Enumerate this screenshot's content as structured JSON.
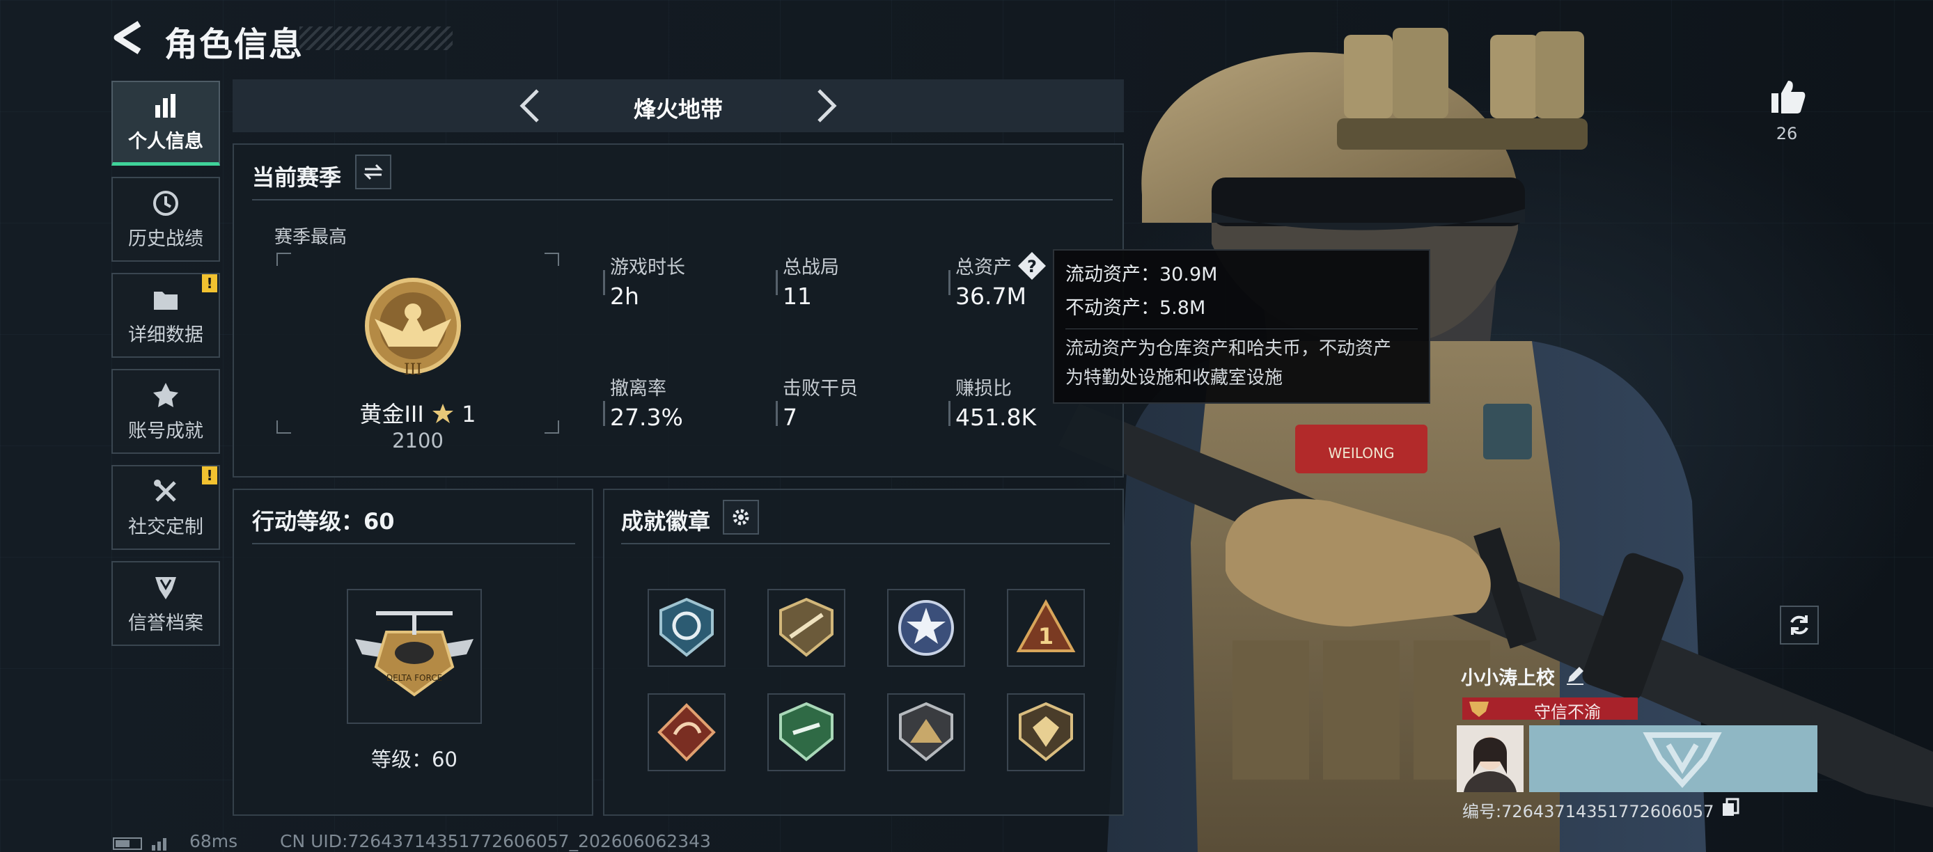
{
  "header": {
    "title": "角色信息"
  },
  "sidebar": {
    "items": [
      {
        "label": "个人信息",
        "icon": "bar-chart-icon",
        "active": true,
        "alert": false
      },
      {
        "label": "历史战绩",
        "icon": "history-clock-icon",
        "active": false,
        "alert": false
      },
      {
        "label": "详细数据",
        "icon": "folder-icon",
        "active": false,
        "alert": true
      },
      {
        "label": "账号成就",
        "icon": "achievement-star-icon",
        "active": false,
        "alert": false
      },
      {
        "label": "社交定制",
        "icon": "tools-icon",
        "active": false,
        "alert": true
      },
      {
        "label": "信誉档案",
        "icon": "reputation-shield-icon",
        "active": false,
        "alert": false
      }
    ],
    "alert_mark": "!"
  },
  "mode_bar": {
    "name": "烽火地带"
  },
  "season": {
    "title": "当前赛季",
    "best_label": "赛季最高",
    "rank_name": "黄金III",
    "rank_stars": "1",
    "rank_points": "2100"
  },
  "stats": [
    {
      "label": "游戏时长",
      "value": "2h"
    },
    {
      "label": "总战局",
      "value": "11"
    },
    {
      "label": "总资产",
      "value": "36.7M",
      "has_help": true
    },
    {
      "label": "撤离率",
      "value": "27.3%"
    },
    {
      "label": "击败干员",
      "value": "7"
    },
    {
      "label": "赚损比",
      "value": "451.8K"
    }
  ],
  "tooltip": {
    "liquid": "流动资产：30.9M",
    "fixed": "不动资产：5.8M",
    "desc_line1": "流动资产为仓库资产和哈夫币，不动资产",
    "desc_line2": "为特勤处设施和收藏室设施"
  },
  "action_level": {
    "title": "行动等级：60",
    "level_text": "等级：60",
    "emblem_text": "DELTA FORCE"
  },
  "achievements": {
    "title": "成就徽章"
  },
  "player": {
    "likes": "26",
    "name": "小小涛上校",
    "reputation": "守信不渝",
    "uid_label": "编号:7264371435177260605​7",
    "patch": "WEILONG"
  },
  "status_bar": {
    "ping": "68ms",
    "uid": "CN UID:72643714351772606057_202606062343"
  },
  "colors": {
    "accent_green": "#3fd39a",
    "alert_yellow": "#f2c230",
    "reputation_red": "#a8222a"
  }
}
